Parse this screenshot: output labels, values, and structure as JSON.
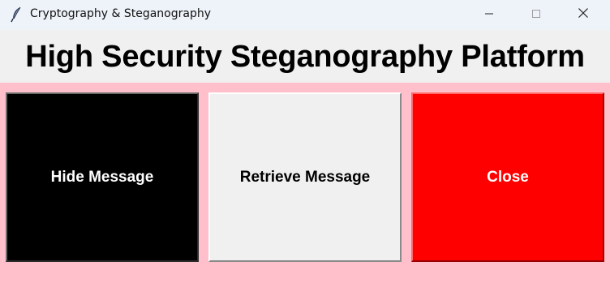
{
  "window": {
    "title": "Cryptography & Steganography",
    "app_icon": "feather-icon",
    "controls": {
      "minimize_icon": "minimize-icon",
      "maximize_icon": "maximize-icon",
      "close_icon": "close-icon"
    }
  },
  "header": {
    "title": "High Security Steganography Platform"
  },
  "actions": {
    "hide_label": "Hide Message",
    "retrieve_label": "Retrieve Message",
    "close_label": "Close"
  },
  "colors": {
    "background": "#ffc0cb",
    "header_band": "#f0f0f0",
    "hide_button": "#000000",
    "retrieve_button": "#f0f0f0",
    "close_button": "#ff0000"
  }
}
